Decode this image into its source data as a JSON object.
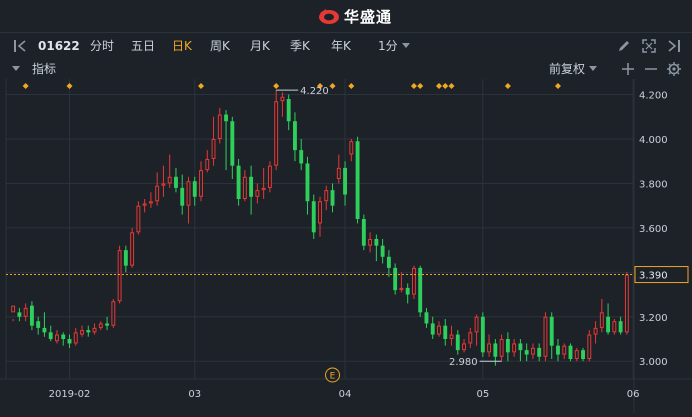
{
  "app": {
    "title": "华盛通"
  },
  "toolbar": {
    "code": "01622",
    "periods": [
      {
        "label": "分时",
        "active": false
      },
      {
        "label": "五日",
        "active": false
      },
      {
        "label": "日K",
        "active": true
      },
      {
        "label": "周K",
        "active": false
      },
      {
        "label": "月K",
        "active": false
      },
      {
        "label": "季K",
        "active": false
      },
      {
        "label": "年K",
        "active": false
      }
    ],
    "minute_select": "1分"
  },
  "indicator_bar": {
    "label": "指标",
    "adjust": "前复权"
  },
  "colors": {
    "up": "#e53935",
    "down": "#2fcf5c",
    "accent": "#f0a724",
    "bg": "#1d2229",
    "grid": "#2c333c"
  },
  "chart_data": {
    "type": "candlestick",
    "y_ticks": [
      "4.200",
      "4.000",
      "3.800",
      "3.600",
      "3.400",
      "3.200",
      "3.000"
    ],
    "y_tick_values": [
      4.2,
      4.0,
      3.8,
      3.6,
      3.4,
      3.2,
      3.0
    ],
    "ylim": [
      2.92,
      4.27
    ],
    "x_ticks": [
      {
        "label": "2019-02",
        "index": 9
      },
      {
        "label": "03",
        "index": 29
      },
      {
        "label": "04",
        "index": 53
      },
      {
        "label": "05",
        "index": 75
      },
      {
        "label": "06",
        "index": 99
      }
    ],
    "last_price": "3.390",
    "last_value": 3.39,
    "max_label": "4.220",
    "max_index": 42,
    "min_label": "2.980",
    "min_index": 78,
    "event_label": "E",
    "event_index": 51,
    "marker_indices": [
      2,
      9,
      30,
      42,
      49,
      51,
      54,
      64,
      65,
      68,
      69,
      70,
      79,
      87
    ],
    "candles": [
      [
        3.22,
        3.25,
        3.19,
        3.18
      ],
      [
        3.22,
        3.2,
        3.24,
        3.18
      ],
      [
        3.2,
        3.24,
        3.26,
        3.18
      ],
      [
        3.25,
        3.16,
        3.27,
        3.14
      ],
      [
        3.18,
        3.15,
        3.2,
        3.12
      ],
      [
        3.15,
        3.13,
        3.22,
        3.11
      ],
      [
        3.13,
        3.1,
        3.16,
        3.09
      ],
      [
        3.09,
        3.12,
        3.14,
        3.08
      ],
      [
        3.12,
        3.1,
        3.13,
        3.07
      ],
      [
        3.1,
        3.08,
        3.12,
        3.06
      ],
      [
        3.08,
        3.13,
        3.15,
        3.07
      ],
      [
        3.12,
        3.14,
        3.16,
        3.11
      ],
      [
        3.14,
        3.13,
        3.16,
        3.11
      ],
      [
        3.13,
        3.15,
        3.17,
        3.12
      ],
      [
        3.15,
        3.17,
        3.18,
        3.14
      ],
      [
        3.17,
        3.16,
        3.2,
        3.14
      ],
      [
        3.16,
        3.27,
        3.28,
        3.15
      ],
      [
        3.27,
        3.5,
        3.52,
        3.26
      ],
      [
        3.5,
        3.43,
        3.52,
        3.4
      ],
      [
        3.43,
        3.58,
        3.6,
        3.42
      ],
      [
        3.58,
        3.7,
        3.72,
        3.57
      ],
      [
        3.7,
        3.71,
        3.73,
        3.67
      ],
      [
        3.71,
        3.72,
        3.76,
        3.69
      ],
      [
        3.72,
        3.79,
        3.85,
        3.7
      ],
      [
        3.79,
        3.8,
        3.88,
        3.74
      ],
      [
        3.8,
        3.83,
        3.93,
        3.78
      ],
      [
        3.83,
        3.78,
        3.87,
        3.76
      ],
      [
        3.78,
        3.7,
        3.84,
        3.66
      ],
      [
        3.7,
        3.81,
        3.83,
        3.62
      ],
      [
        3.81,
        3.74,
        3.83,
        3.7
      ],
      [
        3.74,
        3.86,
        3.9,
        3.72
      ],
      [
        3.86,
        3.91,
        3.95,
        3.85
      ],
      [
        3.91,
        4.0,
        4.1,
        3.88
      ],
      [
        4.0,
        4.11,
        4.14,
        3.98
      ],
      [
        4.11,
        4.08,
        4.13,
        3.86
      ],
      [
        4.08,
        3.88,
        4.1,
        3.82
      ],
      [
        3.88,
        3.73,
        3.91,
        3.7
      ],
      [
        3.73,
        3.83,
        3.86,
        3.72
      ],
      [
        3.83,
        3.74,
        3.88,
        3.66
      ],
      [
        3.74,
        3.77,
        3.8,
        3.71
      ],
      [
        3.77,
        3.78,
        3.87,
        3.73
      ],
      [
        3.78,
        3.88,
        3.9,
        3.76
      ],
      [
        3.88,
        4.17,
        4.22,
        3.86
      ],
      [
        4.17,
        4.19,
        4.21,
        4.1
      ],
      [
        4.18,
        4.08,
        4.2,
        4.04
      ],
      [
        4.08,
        3.95,
        4.12,
        3.9
      ],
      [
        3.95,
        3.89,
        4.0,
        3.86
      ],
      [
        3.89,
        3.72,
        3.92,
        3.66
      ],
      [
        3.72,
        3.58,
        3.75,
        3.55
      ],
      [
        3.62,
        3.72,
        3.74,
        3.56
      ],
      [
        3.72,
        3.77,
        3.79,
        3.68
      ],
      [
        3.77,
        3.7,
        3.8,
        3.67
      ],
      [
        3.82,
        3.87,
        3.93,
        3.8
      ],
      [
        3.87,
        3.75,
        3.9,
        3.7
      ],
      [
        3.93,
        3.99,
        4.0,
        3.9
      ],
      [
        3.99,
        3.64,
        4.01,
        3.62
      ],
      [
        3.64,
        3.52,
        3.66,
        3.5
      ],
      [
        3.52,
        3.55,
        3.58,
        3.49
      ],
      [
        3.55,
        3.52,
        3.57,
        3.45
      ],
      [
        3.52,
        3.47,
        3.55,
        3.44
      ],
      [
        3.47,
        3.42,
        3.5,
        3.38
      ],
      [
        3.42,
        3.32,
        3.44,
        3.3
      ],
      [
        3.32,
        3.33,
        3.4,
        3.31
      ],
      [
        3.33,
        3.3,
        3.35,
        3.26
      ],
      [
        3.3,
        3.42,
        3.43,
        3.28
      ],
      [
        3.42,
        3.22,
        3.43,
        3.2
      ],
      [
        3.22,
        3.17,
        3.24,
        3.15
      ],
      [
        3.17,
        3.12,
        3.2,
        3.1
      ],
      [
        3.12,
        3.16,
        3.18,
        3.11
      ],
      [
        3.16,
        3.1,
        3.19,
        3.07
      ],
      [
        3.1,
        3.12,
        3.16,
        3.07
      ],
      [
        3.12,
        3.05,
        3.14,
        3.03
      ],
      [
        3.05,
        3.08,
        3.1,
        3.04
      ],
      [
        3.08,
        3.13,
        3.15,
        3.06
      ],
      [
        3.13,
        3.2,
        3.21,
        3.07
      ],
      [
        3.2,
        3.04,
        3.22,
        3.02
      ],
      [
        3.04,
        3.08,
        3.12,
        3.02
      ],
      [
        3.08,
        3.02,
        3.1,
        2.98
      ],
      [
        3.02,
        3.1,
        3.12,
        3.0
      ],
      [
        3.1,
        3.04,
        3.13,
        3.0
      ],
      [
        3.04,
        3.08,
        3.1,
        3.02
      ],
      [
        3.08,
        3.05,
        3.1,
        3.0
      ],
      [
        3.05,
        3.03,
        3.08,
        3.0
      ],
      [
        3.03,
        3.06,
        3.08,
        3.01
      ],
      [
        3.06,
        3.02,
        3.08,
        3.0
      ],
      [
        3.02,
        3.2,
        3.22,
        3.0
      ],
      [
        3.2,
        3.07,
        3.22,
        3.01
      ],
      [
        3.07,
        3.03,
        3.1,
        3.0
      ],
      [
        3.03,
        3.07,
        3.08,
        3.01
      ],
      [
        3.07,
        3.01,
        3.08,
        3.0
      ],
      [
        3.01,
        3.05,
        3.06,
        3.0
      ],
      [
        3.05,
        3.01,
        3.06,
        3.0
      ],
      [
        3.01,
        3.12,
        3.14,
        3.0
      ],
      [
        3.12,
        3.15,
        3.18,
        3.08
      ],
      [
        3.15,
        3.22,
        3.28,
        3.13
      ],
      [
        3.2,
        3.13,
        3.26,
        3.12
      ],
      [
        3.13,
        3.18,
        3.19,
        3.12
      ],
      [
        3.18,
        3.13,
        3.2,
        3.12
      ],
      [
        3.13,
        3.39,
        3.4,
        3.12
      ]
    ]
  }
}
